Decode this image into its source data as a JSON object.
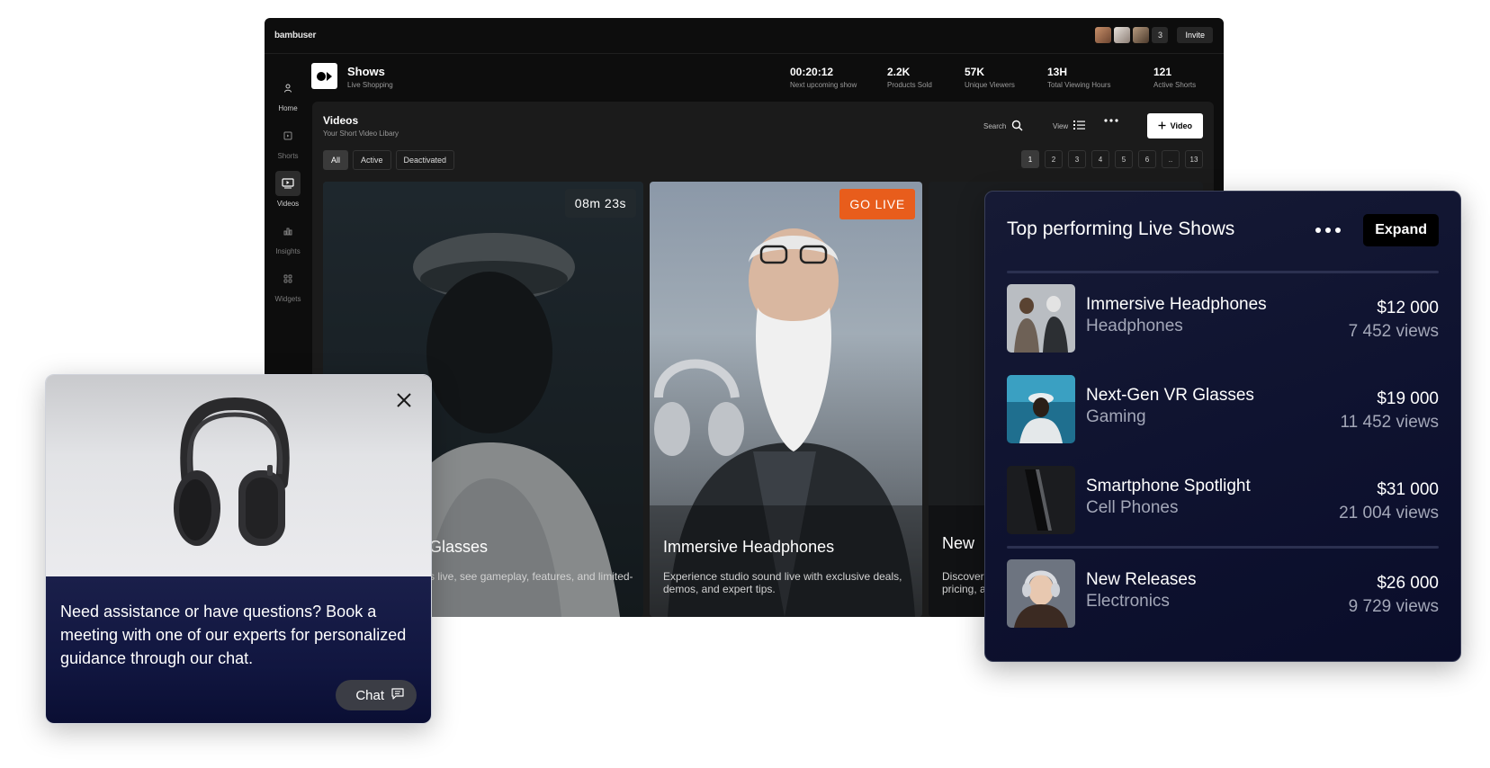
{
  "app": {
    "brand": "bambuser",
    "avatar_count": "3",
    "invite_label": "Invite"
  },
  "sidebar": {
    "items": [
      {
        "label": "Home",
        "icon": "user-icon"
      },
      {
        "label": "Shorts",
        "icon": "shorts-icon"
      },
      {
        "label": "Videos",
        "icon": "video-icon"
      },
      {
        "label": "Insights",
        "icon": "chart-icon"
      },
      {
        "label": "Widgets",
        "icon": "widgets-icon"
      }
    ],
    "active": "Videos"
  },
  "shows": {
    "title": "Shows",
    "subtitle": "Live Shopping",
    "stats": [
      {
        "value": "00:20:12",
        "label": "Next upcoming show"
      },
      {
        "value": "2.2K",
        "label": "Products Sold"
      },
      {
        "value": "57K",
        "label": "Unique Viewers"
      },
      {
        "value": "13H",
        "label": "Total Viewing Hours"
      },
      {
        "value": "121",
        "label": "Active Shorts"
      }
    ]
  },
  "videos": {
    "title": "Videos",
    "subtitle": "Your Short Video Libary",
    "search_label": "Search",
    "view_label": "View",
    "add_label": "Video",
    "filters": [
      "All",
      "Active",
      "Deactivated"
    ],
    "active_filter": "All",
    "pages": [
      "1",
      "2",
      "3",
      "4",
      "5",
      "6",
      "..",
      "13"
    ],
    "active_page": "1",
    "cards": [
      {
        "title": "Glasses",
        "desc": "s live, see gameplay, features, and limited-",
        "badge": "08m 23s"
      },
      {
        "title": "Immersive Headphones",
        "desc": "Experience studio sound live with exclusive deals, demos, and expert tips.",
        "badge": "GO LIVE"
      },
      {
        "title": "New",
        "desc": "Discover pricing, a"
      }
    ]
  },
  "chat": {
    "message": "Need assistance or have questions? Book a meeting with one of our experts for personalized guidance through our chat.",
    "button_label": "Chat"
  },
  "top_performing": {
    "title": "Top performing Live Shows",
    "expand_label": "Expand",
    "rows": [
      {
        "name": "Immersive Headphones",
        "category": "Headphones",
        "amount": "$12 000",
        "views": "7 452 views"
      },
      {
        "name": "Next-Gen VR Glasses",
        "category": "Gaming",
        "amount": "$19 000",
        "views": "11 452 views"
      },
      {
        "name": "Smartphone Spotlight",
        "category": "Cell Phones",
        "amount": "$31 000",
        "views": "21 004 views"
      },
      {
        "name": "New Releases",
        "category": "Electronics",
        "amount": "$26 000",
        "views": "9 729 views"
      }
    ]
  },
  "colors": {
    "accent_live": "#e85d1c",
    "panel_navy": "#0f1330"
  }
}
